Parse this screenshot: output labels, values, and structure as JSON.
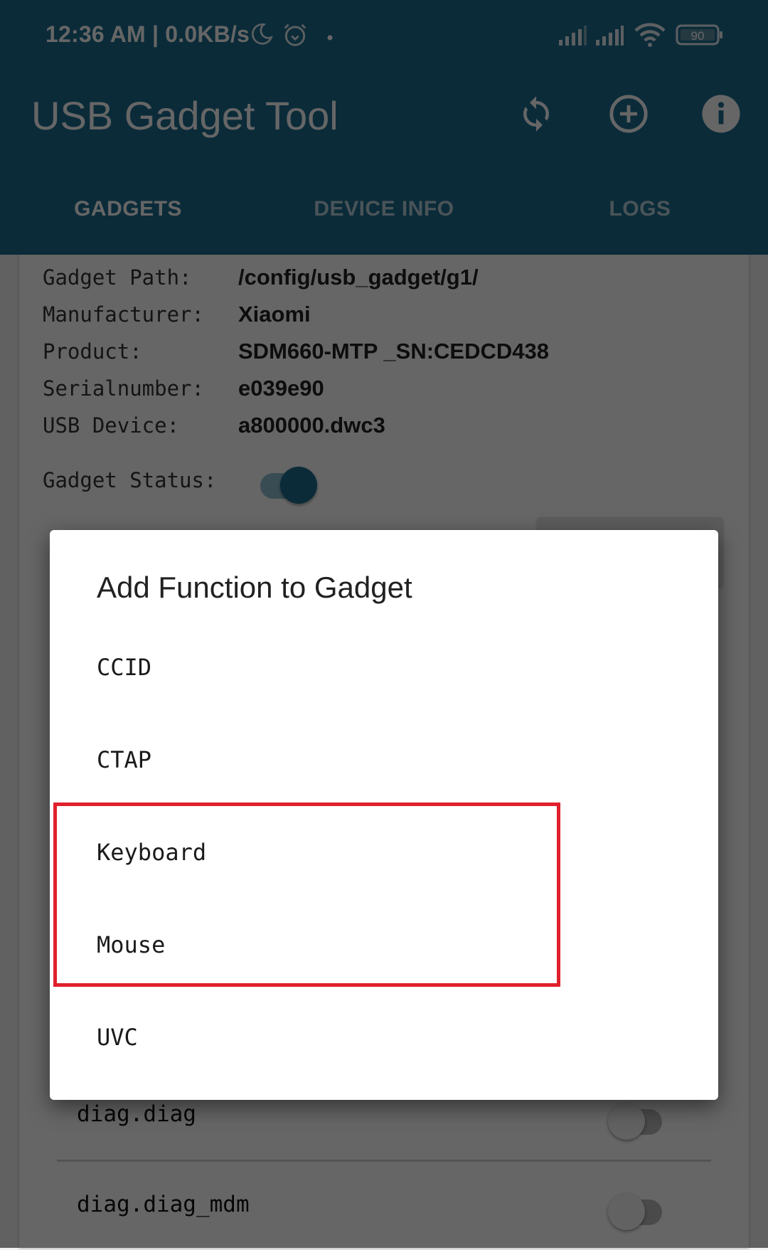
{
  "status_bar": {
    "time": "12:36 AM",
    "separator": "|",
    "net_speed": "0.0KB/s",
    "icons": [
      "do-not-disturb-moon-icon",
      "alarm-icon",
      "notification-dot-icon",
      "signal-sim1-icon",
      "signal-sim2-icon",
      "wifi-icon",
      "battery-icon"
    ],
    "battery_level": "90"
  },
  "app_bar": {
    "title": "USB Gadget Tool",
    "actions": [
      {
        "name": "refresh",
        "icon": "refresh-icon"
      },
      {
        "name": "add",
        "icon": "add-circle-icon"
      },
      {
        "name": "info",
        "icon": "info-icon"
      }
    ]
  },
  "tabs": [
    {
      "label": "GADGETS",
      "active": true
    },
    {
      "label": "DEVICE INFO",
      "active": false
    },
    {
      "label": "LOGS",
      "active": false
    }
  ],
  "gadget": {
    "fields": [
      {
        "label": "Gadget Path:",
        "value": "/config/usb_gadget/g1/"
      },
      {
        "label": "Manufacturer:",
        "value": "Xiaomi"
      },
      {
        "label": "Product:",
        "value": "SDM660-MTP _SN:CEDCD438"
      },
      {
        "label": "Serialnumber:",
        "value": "e039e90"
      },
      {
        "label": "USB Device:",
        "value": "a800000.dwc3"
      }
    ],
    "status_label": "Gadget Status:",
    "status_on": true,
    "functions": [
      {
        "name": "diag.diag",
        "enabled": false
      },
      {
        "name": "diag.diag_mdm",
        "enabled": false
      }
    ]
  },
  "dialog": {
    "title": "Add Function to Gadget",
    "items": [
      "CCID",
      "CTAP",
      "Keyboard",
      "Mouse",
      "UVC"
    ],
    "highlighted_items": [
      "Keyboard",
      "Mouse"
    ],
    "highlight_color": "#e0202a"
  },
  "colors": {
    "primary": "#1d6d8f",
    "toggle_on_track": "#8fbdd0"
  }
}
